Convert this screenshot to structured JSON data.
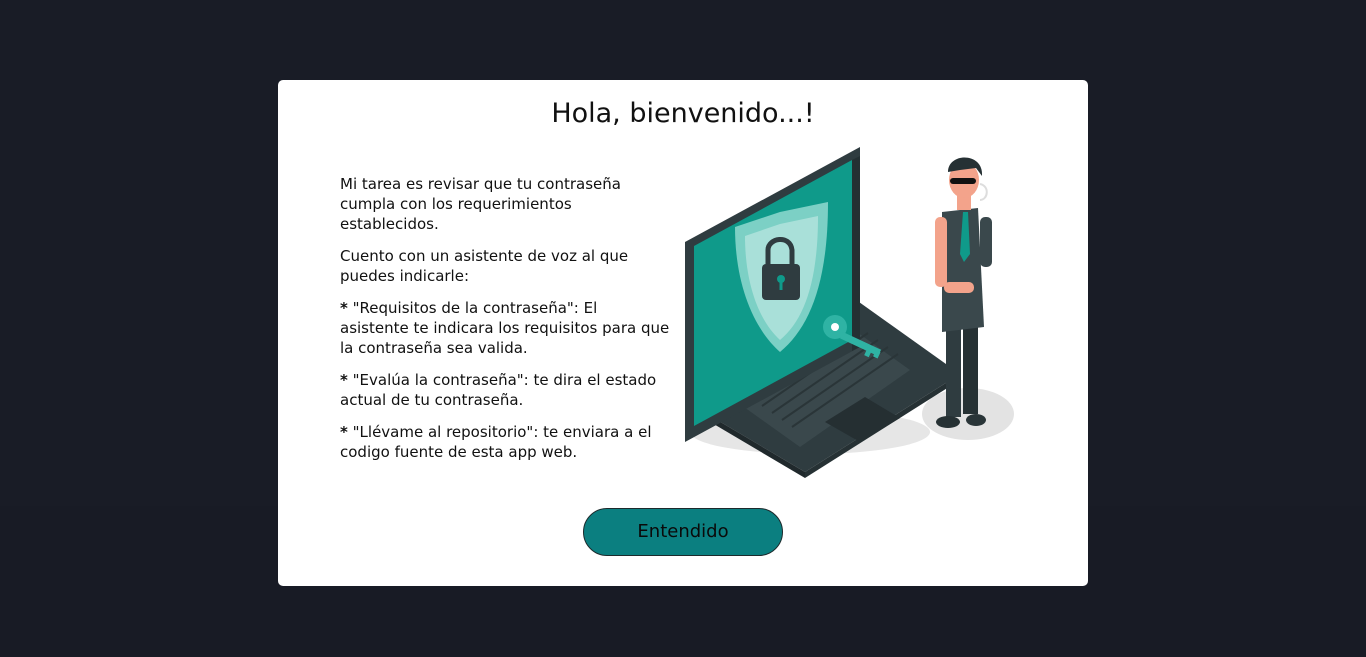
{
  "modal": {
    "title": "Hola, bienvenido...!",
    "paragraphs": [
      "Mi tarea es revisar que tu contraseña cumpla con los requerimientos establecidos.",
      "Cuento con un asistente de voz al que puedes indicarle:"
    ],
    "commands": [
      {
        "bullet": "*",
        "command": "\"Requisitos de la contraseña\"",
        "description": ": El asistente te indicara los requisitos para que la contraseña sea valida."
      },
      {
        "bullet": "*",
        "command": "\"Evalúa la contraseña\"",
        "description": ": te dira el estado actual de tu contraseña."
      },
      {
        "bullet": "*",
        "command": "\"Llévame al repositorio\"",
        "description": ": te enviara a el codigo fuente de esta app web."
      }
    ],
    "button_label": "Entendido"
  },
  "illustration_icon": "security-laptop-guard-illustration",
  "colors": {
    "background": "#191c26",
    "modal": "#ffffff",
    "accent": "#0b7f80",
    "screen": "#0f9a8a"
  }
}
